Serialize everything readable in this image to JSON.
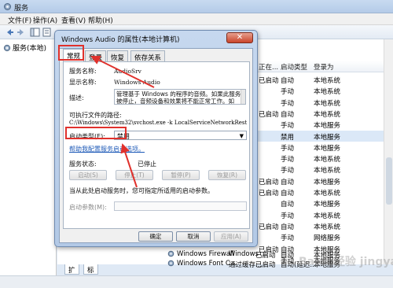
{
  "window": {
    "title": "服务"
  },
  "menu": [
    "文件(F)",
    "操作(A)",
    "查看(V)",
    "帮助(H)"
  ],
  "tree": {
    "node_label": "服务(本地)"
  },
  "services_list": {
    "columns": [
      "启动类型",
      "登录为"
    ],
    "partial_status_col": "正在...",
    "rows": [
      {
        "status": "已启动",
        "startup": "自动",
        "logon": "本地系统"
      },
      {
        "status": "",
        "startup": "手动",
        "logon": "本地系统"
      },
      {
        "status": "",
        "startup": "手动",
        "logon": "本地系统"
      },
      {
        "status": "已启动",
        "startup": "自动",
        "logon": "本地系统"
      },
      {
        "status": "",
        "startup": "手动",
        "logon": "本地服务"
      },
      {
        "status": "",
        "startup": "禁用",
        "logon": "本地服务",
        "selected": true
      },
      {
        "status": "",
        "startup": "手动",
        "logon": "本地服务"
      },
      {
        "status": "",
        "startup": "手动",
        "logon": "本地系统"
      },
      {
        "status": "",
        "startup": "手动",
        "logon": "本地系统"
      },
      {
        "status": "已启动",
        "startup": "自动",
        "logon": "本地服务"
      },
      {
        "status": "已启动",
        "startup": "自动",
        "logon": "本地系统"
      },
      {
        "status": "",
        "startup": "自动",
        "logon": "本地服务"
      },
      {
        "status": "",
        "startup": "手动",
        "logon": "本地系统"
      },
      {
        "status": "已启动",
        "startup": "自动",
        "logon": "本地系统"
      },
      {
        "status": "",
        "startup": "手动",
        "logon": "网络服务"
      },
      {
        "status": "已启动",
        "startup": "自动",
        "logon": "本地服务"
      },
      {
        "status": "",
        "startup": "手动",
        "logon": "本地服务"
      }
    ],
    "bottom_rows": [
      {
        "name": "Windows Firewall",
        "desc": "Windows ...",
        "status": "已启动",
        "startup": "自动",
        "logon": "本地服务"
      },
      {
        "name": "Windows Font C...",
        "desc": "通过缓存...",
        "status": "已启动",
        "startup": "自动(延迟...",
        "logon": "本地服务"
      }
    ]
  },
  "bottom_tabs": [
    "扩展",
    "标准"
  ],
  "dialog": {
    "title": "Windows Audio 的属性(本地计算机)",
    "close": "✕",
    "tabs": [
      "常规",
      "登录",
      "恢复",
      "依存关系"
    ],
    "service_name_label": "服务名称:",
    "service_name": "AudioSrv",
    "display_name_label": "显示名称:",
    "display_name": "Windows Audio",
    "desc_label": "描述:",
    "desc_line1": "管理基于 Windows 的程序的音频。如果此服务",
    "desc_line2": "被停止，音频设备和效果将不能正常工作。如",
    "path_label": "可执行文件的路径:",
    "path": "C:\\Windows\\System32\\svchost.exe -k LocalServiceNetworkRestri",
    "startup_label": "启动类型(E):",
    "startup_value": "禁用",
    "help_link": "帮助我配置服务启动选项。",
    "status_label": "服务状态:",
    "status_value": "已停止",
    "btn_start": "启动(S)",
    "btn_stop": "停止(T)",
    "btn_pause": "暂停(P)",
    "btn_resume": "恢复(R)",
    "hint": "当从此处启动服务时，您可指定所适用的启动参数。",
    "params_label": "启动参数(M):",
    "btn_ok": "确定",
    "btn_cancel": "取消",
    "btn_apply": "应用(A)"
  },
  "watermark": "Baidu经验 jingyan.baidu.com",
  "colors": {
    "highlight_red": "#e0312c",
    "selection": "#dbe8f7"
  }
}
